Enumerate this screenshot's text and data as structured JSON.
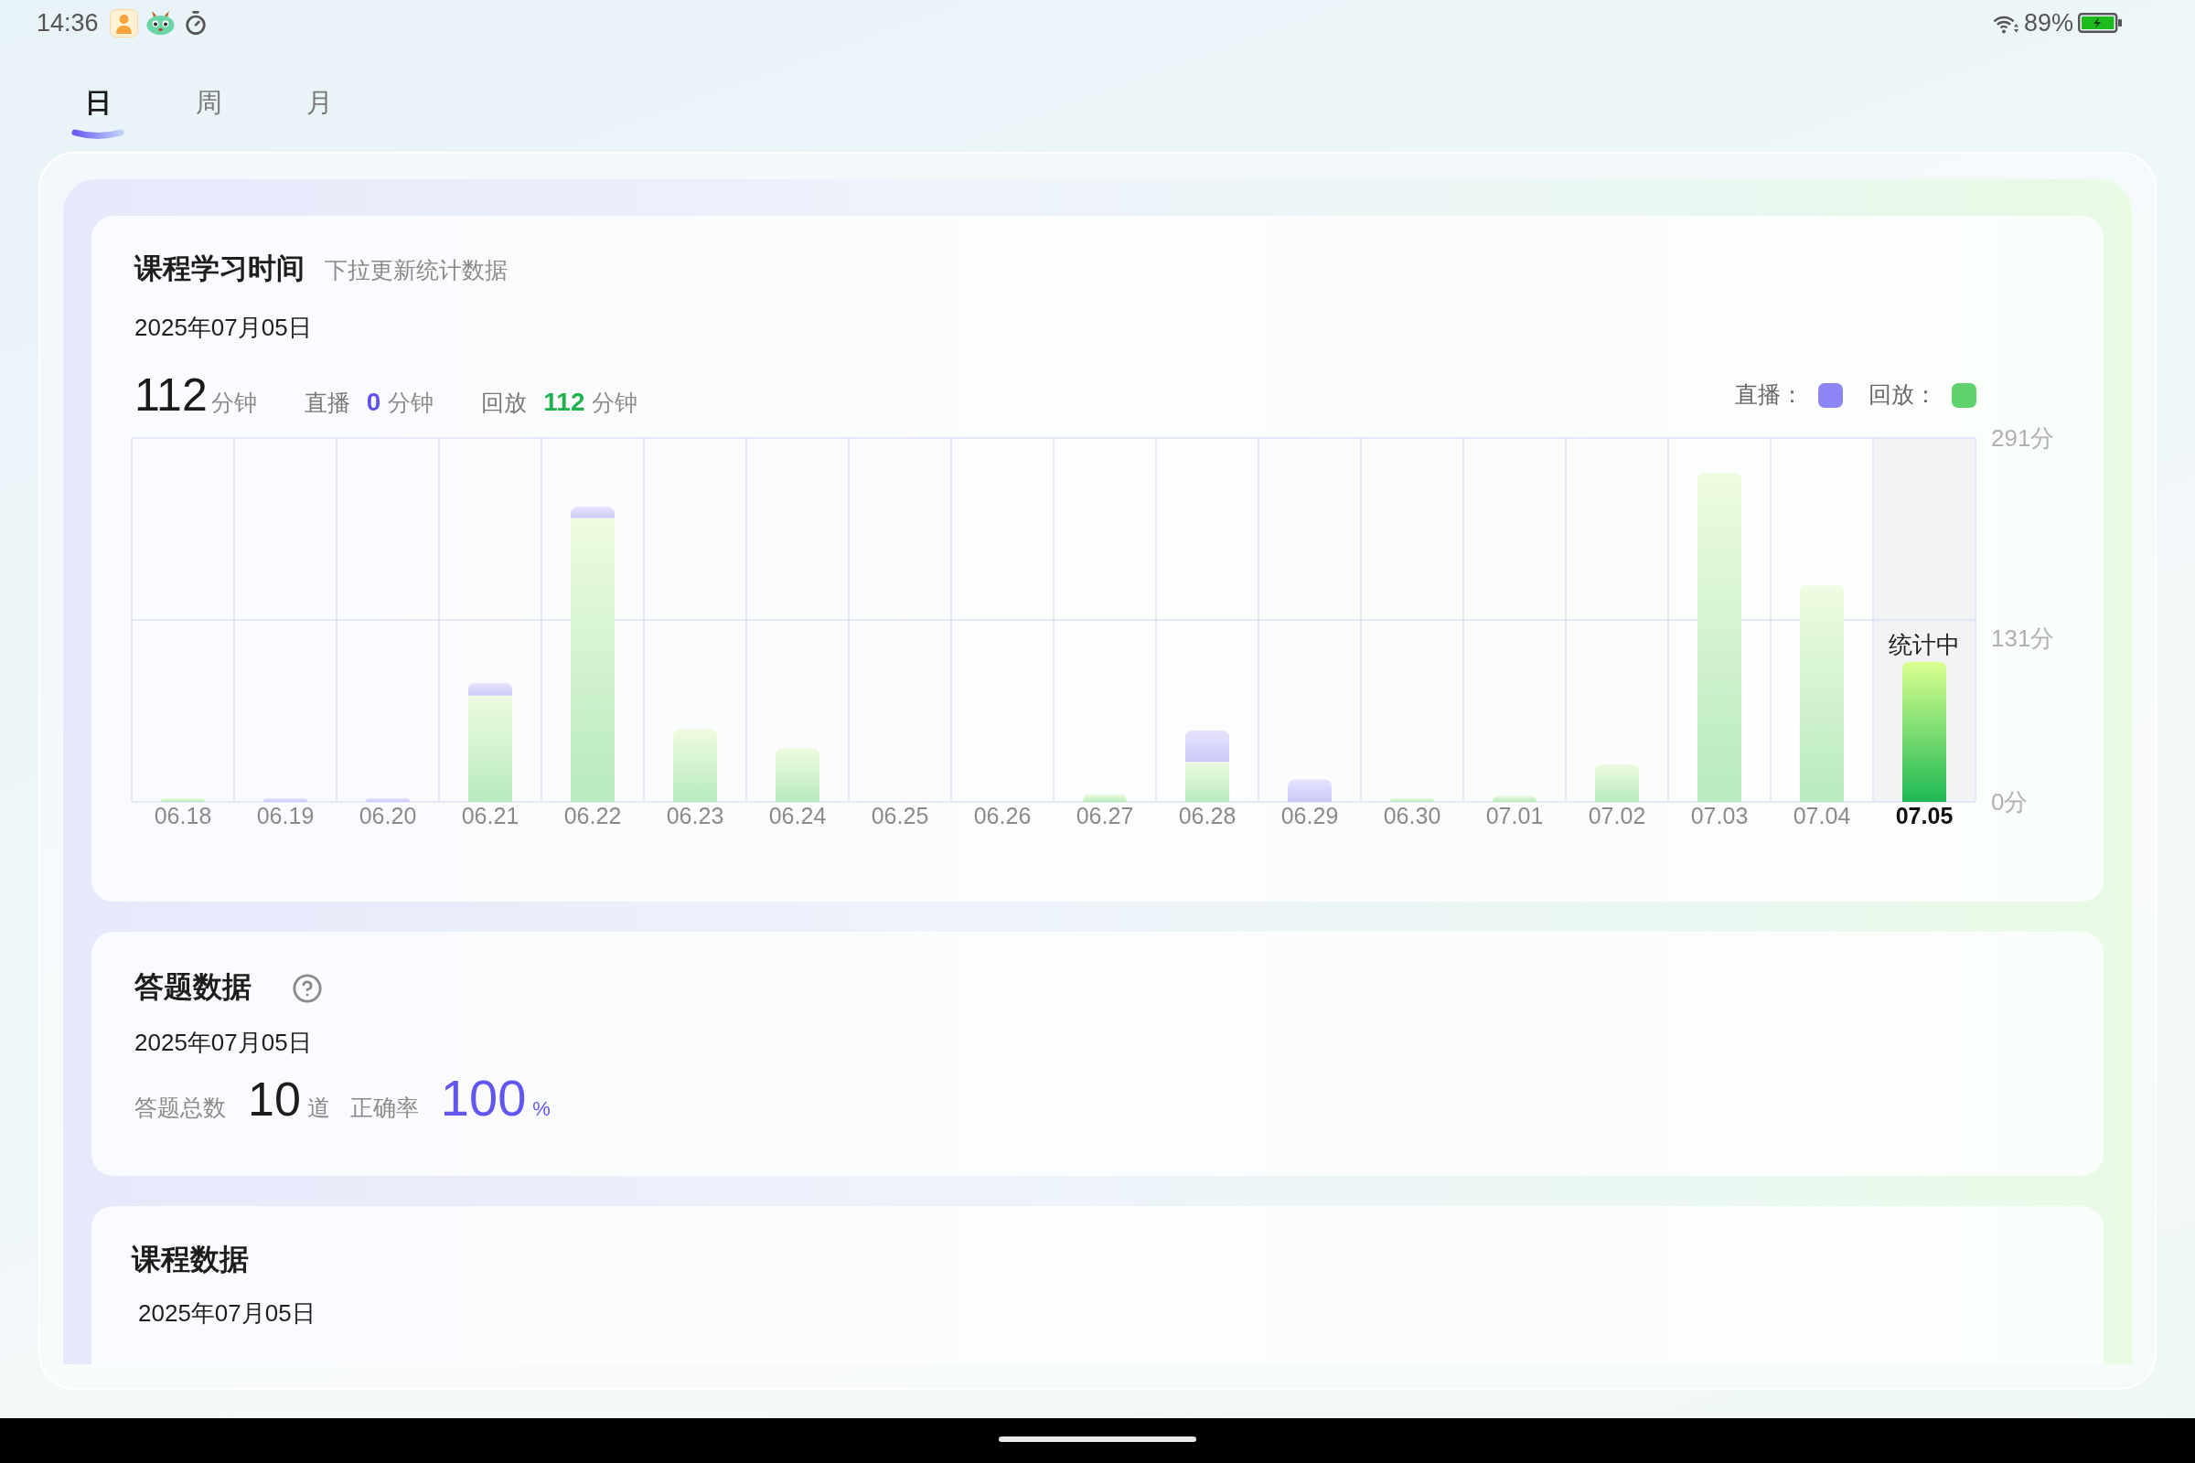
{
  "status_bar": {
    "time": "14:36",
    "battery": "89%"
  },
  "tabs": [
    {
      "label": "日",
      "selected": true
    },
    {
      "label": "周",
      "selected": false
    },
    {
      "label": "月",
      "selected": false
    }
  ],
  "study_time": {
    "title": "课程学习时间",
    "subtitle": "下拉更新统计数据",
    "date": "2025年07月05日",
    "total": {
      "value": "112",
      "unit": "分钟"
    },
    "breakdown": [
      {
        "kind": "live",
        "label": "直播",
        "value": "0",
        "unit": "分钟"
      },
      {
        "kind": "replay",
        "label": "回放",
        "value": "112",
        "unit": "分钟"
      }
    ],
    "chart_data": {
      "type": "bar",
      "stacked": true,
      "categories": [
        "06.18",
        "06.19",
        "06.20",
        "06.21",
        "06.22",
        "06.23",
        "06.24",
        "06.25",
        "06.26",
        "06.27",
        "06.28",
        "06.29",
        "06.30",
        "07.01",
        "07.02",
        "07.03",
        "07.04",
        "07.05"
      ],
      "series": [
        {
          "name": "回放：",
          "color": "#5ed26c",
          "values": [
            3,
            0,
            0,
            85,
            227,
            58,
            43,
            0,
            0,
            6,
            32,
            0,
            3,
            5,
            30,
            263,
            173,
            112
          ]
        },
        {
          "name": "直播：",
          "color": "#8d85f4",
          "values": [
            0,
            3,
            3,
            10,
            9,
            0,
            0,
            0,
            0,
            0,
            25,
            18,
            0,
            0,
            0,
            0,
            0,
            0
          ]
        }
      ],
      "ylim": [
        0,
        291
      ],
      "yticks": [
        {
          "value": 0,
          "label": "0分"
        },
        {
          "value": 131,
          "label": "131分"
        },
        {
          "value": 291,
          "label": "291分"
        }
      ],
      "annotations": [
        "统计中"
      ]
    }
  },
  "answer_data": {
    "title": "答题数据",
    "date": "2025年07月05日",
    "stats": [
      {
        "kind": "count",
        "label": "答题总数",
        "value": "10",
        "unit": "道"
      },
      {
        "kind": "rate",
        "label": "正确率",
        "value": "100",
        "unit": "%"
      }
    ]
  },
  "course_data": {
    "title": "课程数据",
    "date": "2025年07月05日"
  }
}
